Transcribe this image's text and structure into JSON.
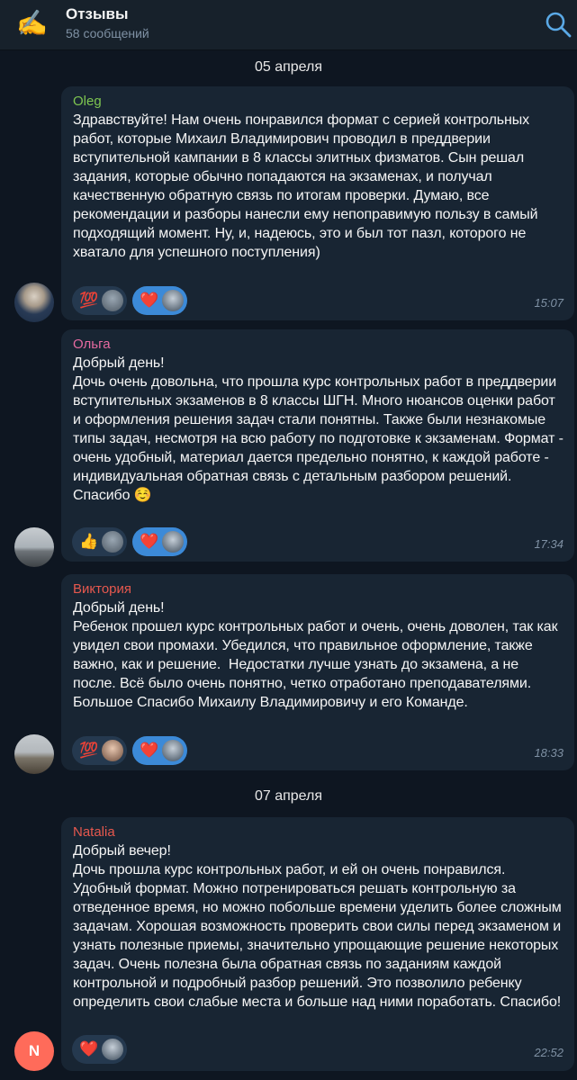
{
  "header": {
    "title": "Отзывы",
    "subtitle": "58 сообщений",
    "icon": "writing-hand-emoji",
    "search_icon": "search-icon"
  },
  "dates": [
    "05 апреля",
    "07 апреля"
  ],
  "messages": [
    {
      "author": "Oleg",
      "author_color": "#7ec650",
      "text": "Здравствуйте! Нам очень понравился формат с серией контрольных работ, которые Михаил Владимирович проводил в преддверии вступительной кампании в 8 классы элитных физматов. Сын решал задания, которые обычно попадаются на экзаменах, и получал качественную обратную связь по итогам проверки. Думаю, все рекомендации и разборы нанесли ему непоправимую пользу в самый подходящий момент. Ну, и, надеюсь, это и был тот пазл, которого не хватало для успешного поступления)",
      "reactions": [
        {
          "emoji": "💯",
          "mine": false
        },
        {
          "emoji": "❤️",
          "mine": true
        }
      ],
      "time": "15:07",
      "avatar": "photo"
    },
    {
      "author": "Ольга",
      "author_color": "#e56aa0",
      "text": "Добрый день!\nДочь очень довольна, что прошла курс контрольных работ в преддверии вступительных экзаменов в 8 классы ШГН. Много нюансов оценки работ и оформления решения задач стали понятны. Также были незнакомые типы задач, несмотря на всю работу по подготовке к экзаменам. Формат - очень удобный, материал дается предельно понятно, к каждой работе - индивидуальная обратная связь с детальным разбором решений. Спасибо ☺️",
      "reactions": [
        {
          "emoji": "👍",
          "mine": false
        },
        {
          "emoji": "❤️",
          "mine": true
        }
      ],
      "time": "17:34",
      "avatar": "photo"
    },
    {
      "author": "Виктория",
      "author_color": "#e6584e",
      "text": "Добрый день!\nРебенок прошел курс контрольных работ и очень, очень доволен, так как увидел свои промахи. Убедился, что правильное оформление, также важно, как и решение.  Недостатки лучше узнать до экзамена, а не после. Всё было очень понятно, четко отработано преподавателями. Большое Спасибо Михаилу Владимировичу и его Команде.",
      "reactions": [
        {
          "emoji": "💯",
          "mine": false
        },
        {
          "emoji": "❤️",
          "mine": true
        }
      ],
      "time": "18:33",
      "avatar": "photo"
    },
    {
      "author": "Natalia",
      "author_color": "#e6584e",
      "text": "Добрый вечер!\nДочь прошла курс контрольных работ, и ей он очень понравился. Удобный формат. Можно потренироваться решать контрольную за отведенное время, но можно побольше времени уделить более сложным задачам. Хорошая возможность проверить свои силы перед экзаменом и узнать полезные приемы, значительно упрощающие решение некоторых задач. Очень полезна была обратная связь по заданиям каждой контрольной и подробный разбор решений. Это позволило ребенку определить свои слабые места и больше над ними поработать. Спасибо!",
      "reactions": [
        {
          "emoji": "❤️",
          "mine": false
        }
      ],
      "time": "22:52",
      "avatar": "N"
    }
  ]
}
